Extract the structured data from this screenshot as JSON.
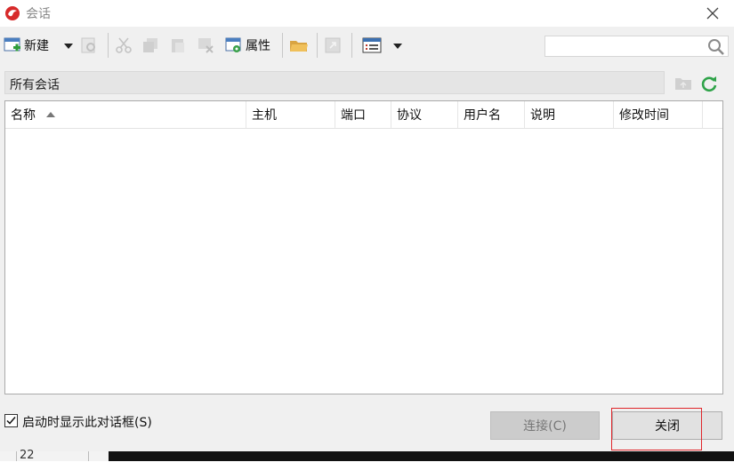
{
  "window": {
    "title": "会话"
  },
  "toolbar": {
    "new_label": "新建",
    "properties_label": "属性"
  },
  "search": {
    "placeholder": ""
  },
  "path": {
    "label": "所有会话"
  },
  "list": {
    "columns": [
      "名称",
      "主机",
      "端口",
      "协议",
      "用户名",
      "说明",
      "修改时间"
    ],
    "rows": []
  },
  "footer": {
    "show_on_startup_label": "启动时显示此对话框(S)",
    "show_on_startup_checked": true,
    "connect_label": "连接(C)",
    "close_label": "关闭"
  },
  "background": {
    "line_number": "22"
  }
}
